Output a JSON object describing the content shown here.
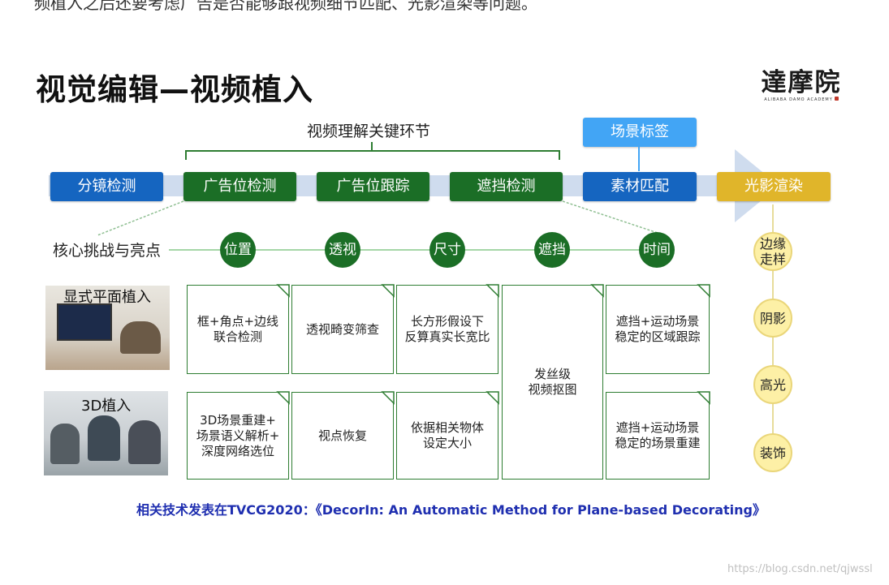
{
  "header_text": "频植入之后还要考虑广告是否能够跟视频细节匹配、光影渲染等问题。",
  "title": "视觉编辑—视频植入",
  "logo": {
    "main": "達摩院",
    "sub": "ALIBABA DAMO ACADEMY"
  },
  "section_label": "视频理解关键环节",
  "pipeline": [
    {
      "label": "分镜检测",
      "color": "#1565c0"
    },
    {
      "label": "广告位检测",
      "color": "#1b6e26"
    },
    {
      "label": "广告位跟踪",
      "color": "#1b6e26"
    },
    {
      "label": "遮挡检测",
      "color": "#1b6e26"
    },
    {
      "label": "素材匹配",
      "color": "#1565c0"
    },
    {
      "label": "光影渲染",
      "color": "#e0b52a"
    }
  ],
  "scene_tag": "场景标签",
  "core_label": "核心挑战与亮点",
  "challenges": [
    "位置",
    "透视",
    "尺寸",
    "遮挡",
    "时间"
  ],
  "lighting_items": [
    "边缘\n走样",
    "阴影",
    "高光",
    "装饰"
  ],
  "rows": [
    {
      "label": "显式平面植入",
      "cells": [
        "框+角点+边线\n联合检测",
        "透视畸变筛查",
        "长方形假设下\n反算真实长宽比",
        "遮挡+运动场景\n稳定的区域跟踪"
      ]
    },
    {
      "label": "3D植入",
      "cells": [
        "3D场景重建+\n场景语义解析+\n深度网络选位",
        "视点恢复",
        "依据相关物体\n设定大小",
        "遮挡+运动场景\n稳定的场景重建"
      ]
    }
  ],
  "shared_cell": "发丝级\n视频抠图",
  "citation": "相关技术发表在TVCG2020：《DecorIn: An Automatic Method for Plane-based Decorating》",
  "watermark": "https://blog.csdn.net/qjwssl"
}
